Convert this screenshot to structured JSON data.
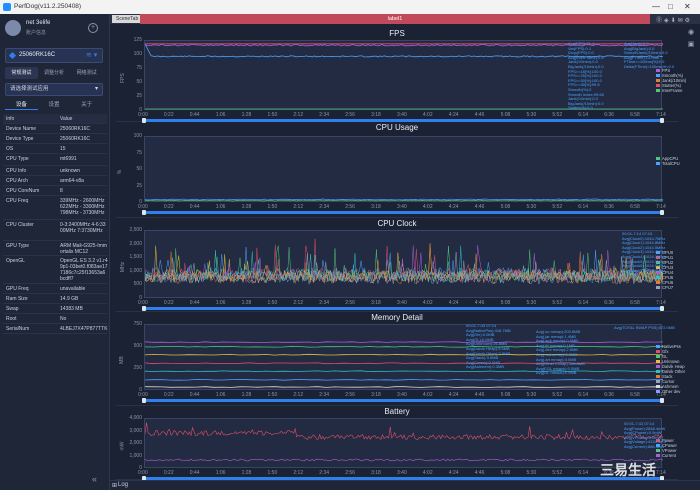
{
  "window": {
    "title": "PerfDog(v11.2.250408)"
  },
  "user": {
    "name": "net 3elife",
    "sub": "账户信息"
  },
  "device": {
    "name": "25060RK16C"
  },
  "mode_tabs": [
    "常规测试",
    "调整分析",
    "网络测试"
  ],
  "app_select": {
    "placeholder": "请选择测试应用"
  },
  "sub_tabs": [
    "设备",
    "设置",
    "关于"
  ],
  "info": {
    "header": {
      "k": "Info",
      "v": "Value"
    },
    "rows": [
      {
        "k": "Device Name",
        "v": "25060RK16C"
      },
      {
        "k": "Device Type",
        "v": "25060RK16C"
      },
      {
        "k": "OS",
        "v": "15"
      },
      {
        "k": "CPU Type",
        "v": "mt6991"
      },
      {
        "k": "CPU Info",
        "v": "unknown"
      },
      {
        "k": "CPU Arch",
        "v": "arm64-v8a"
      },
      {
        "k": "CPU CoreNum",
        "v": "8"
      },
      {
        "k": "CPU Freq",
        "v": "339MHz - 2600MHz 622MHz - 3300MHz 798MHz - 3730MHz"
      },
      {
        "k": "CPU Cluster",
        "v": "0-3:2400MHz 4-6:3300MHz 7:3730MHz"
      },
      {
        "k": "GPU Type",
        "v": "ARM Mali-G925-Immortalis MC12"
      },
      {
        "k": "OpenGL",
        "v": "OpenGL ES 3.2 v1.r49p1-03bet0.f083ae177186c7c25f13653a6bcdff7"
      },
      {
        "k": "GPU Freq",
        "v": "unavailable"
      },
      {
        "k": "Ram Size",
        "v": "14.9 GB"
      },
      {
        "k": "Swap",
        "v": "14383 MB"
      },
      {
        "k": "Root",
        "v": "No"
      },
      {
        "k": "SerialNum",
        "v": "4LBEJ7X47P877TTK"
      }
    ]
  },
  "tabs": {
    "left": "SceneTab",
    "label": "label1"
  },
  "log": {
    "label": "Log"
  },
  "watermark": "三易生活",
  "time_ticks": [
    "0:00",
    "0:22",
    "0:44",
    "1:06",
    "1:28",
    "1:50",
    "2:12",
    "2:34",
    "2:56",
    "3:18",
    "3:40",
    "4:02",
    "4:24",
    "4:46",
    "5:08",
    "5:30",
    "5:52",
    "6:14",
    "6:36",
    "6:58",
    "7:14"
  ],
  "panels": {
    "fps": {
      "title": "FPS",
      "ylabel": "FPS",
      "yticks": [
        "125",
        "100",
        "75",
        "50",
        "25",
        "0"
      ],
      "legend": [
        {
          "name": "FPS",
          "color": "#b05dd9"
        },
        {
          "name": "Smooth(%)",
          "color": "#4aa3ff"
        },
        {
          "name": "Jank(/10min)",
          "color": "#e08030"
        },
        {
          "name": "Stutter(%)",
          "color": "#e0506a"
        },
        {
          "name": "InterFrame",
          "color": "#50c878"
        }
      ],
      "ann1": "Avg(FPS):71.4\nVar(FPS):0.1\nDrop(FPS):0.0\nAvg(InterFrame):0.5\nJank(/10min):0.0\nBigJank(/10min):0.0\nFPS>=18[%]:100.0\nFPS>=25[%]:100.0\nFPS>=30[%]:100.0\nFPS>=45[%]:99.8\nSmooth(%):0\nSmooth Index:99.66\nJank(/10min):0.0\nBigJank(/10min):0.0\nStutter(%):0.0",
      "ann2": "Avg(Jank):0.0\nAvg(BigJank):0.0\nSmoothJank(/10min):0.0\nAvg(FTime):14.0ms\nFTime>=100ms[%]:0.0\nDelta(FTime)>100ms(/h):0.0"
    },
    "cpu_usage": {
      "title": "CPU Usage",
      "ylabel": "%",
      "yticks": [
        "100",
        "75",
        "50",
        "25",
        "0"
      ],
      "legend": [
        {
          "name": "AppCPU",
          "color": "#50c878"
        },
        {
          "name": "TotalCPU",
          "color": "#4aa3ff"
        }
      ]
    },
    "cpu_clock": {
      "title": "CPU Clock",
      "ylabel": "MHz",
      "yticks": [
        "2,500",
        "2,000",
        "1,500",
        "1,000",
        "500",
        "0"
      ],
      "legend": [
        {
          "name": "CPU0",
          "color": "#4aa3ff"
        },
        {
          "name": "CPU1",
          "color": "#e0506a"
        },
        {
          "name": "CPU2",
          "color": "#50c878"
        },
        {
          "name": "CPU3",
          "color": "#e0c040"
        },
        {
          "name": "CPU4",
          "color": "#b05dd9"
        },
        {
          "name": "CPU5",
          "color": "#30c0c0"
        },
        {
          "name": "CPU6",
          "color": "#e08030"
        },
        {
          "name": "CPU7",
          "color": "#9aa4b8"
        }
      ],
      "ann": "00:01-7:14 07:15\nAvg(Clock0):1044.7MHz\nAvg(Clock1):1044.8MHz\nAvg(Clock2):1044.5MHz\nAvg(Clock3):1044.4MHz\nAvg(Clock4):1024.1MHz\nAvg(Clock5):1024.3MHz\nAvg(Clock6):1024.0MHz\nAvg(Clock7):1013.8MHz"
    },
    "memory": {
      "title": "Memory Detail",
      "ylabel": "MB",
      "yticks": [
        "750",
        "500",
        "250",
        "0"
      ],
      "legend": [
        {
          "name": "NativePss",
          "color": "#4aa3ff"
        },
        {
          "name": "Gfx",
          "color": "#e0506a"
        },
        {
          "name": "GL",
          "color": "#50c878"
        },
        {
          "name": "Unknown",
          "color": "#e0c040"
        },
        {
          "name": "Dalvik Heap",
          "color": "#b05dd9"
        },
        {
          "name": "Dalvik Other",
          "color": "#30c0c0"
        },
        {
          "name": "Stack",
          "color": "#e08030"
        },
        {
          "name": "Cursor",
          "color": "#9aa4b8"
        },
        {
          "name": "Ashmem",
          "color": "#d9d9d9"
        },
        {
          "name": "Other dev",
          "color": "#80a0ff"
        }
      ],
      "ann1": "00:01-7:43 07:14\nAvg(NativePss):416.7MB\nAvg(Gfx):0.0MB\nAvg(GL):0.0MB\nAvg(Unknown):26.8MB\nAvg(Dalvik Heap):3.5MB\nAvg(Dalvik Other):7.8MB\nAvg(Stack):3.5MB\nAvg(Cursor):0.0MB\nAvg(Ashmem):0.3MB",
      "ann2": "Avg(.so mmap):200.6MB\nAvg(.jar mmap):1.4MB\nAvg(.apk mmap):0.0MB\nAvg(.ttf mmap):0.1MB\nAvg(.dex mmap):2.8MB\nAvg(.oat mmap):0.0MB\nAvg(.art mmap):4.0MB\nAvg(Other mmap):108.5MB\nAvg(EGL mtrack):0.0MB\nAvg(GL mtrack):0.0MB",
      "ann3": "Avg(TOTAL SWAP PSS):572.0MB"
    },
    "battery": {
      "title": "Battery",
      "ylabel": "mW",
      "yticks": [
        "4,000",
        "3,000",
        "2,000",
        "1,000",
        "0"
      ],
      "legend": [
        {
          "name": "Power",
          "color": "#e0506a"
        },
        {
          "name": "CPower",
          "color": "#4aa3ff"
        },
        {
          "name": "VPower",
          "color": "#50c878"
        },
        {
          "name": "Current",
          "color": "#b05dd9"
        }
      ],
      "ann": "00:01-7:43 07:14\nAvg(Power):2846.4mW\nAvg(CPower):0.0mW\nAvg(VPower):0.0mW\nAvg(Voltage):4134.0mV\nAvg(Current):688.3mA"
    }
  }
}
